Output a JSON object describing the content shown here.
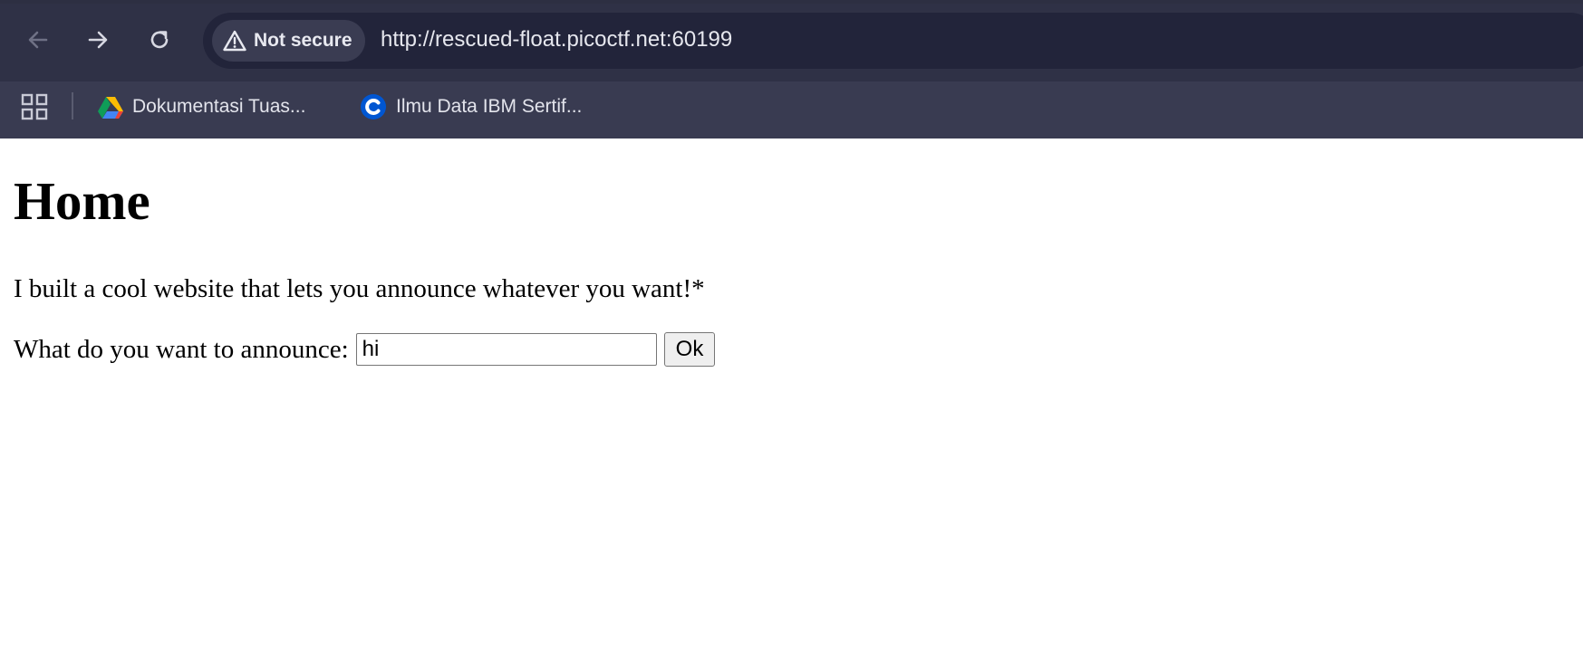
{
  "browser": {
    "security_label": "Not secure",
    "url": "http://rescued-float.picoctf.net:60199",
    "bookmarks": [
      {
        "label": "Dokumentasi Tuas...",
        "icon": "google-drive-icon"
      },
      {
        "label": "Ilmu Data IBM Sertif...",
        "icon": "coursera-icon"
      }
    ]
  },
  "page": {
    "title": "Home",
    "intro": "I built a cool website that lets you announce whatever you want!*",
    "form_label": "What do you want to announce:",
    "input_value": "hi",
    "button_label": "Ok"
  },
  "colors": {
    "chrome_toolbar": "#2f3146",
    "omnibox": "#22243a",
    "bookmarks_bar": "#393b51",
    "page_background": "#ffffff"
  }
}
